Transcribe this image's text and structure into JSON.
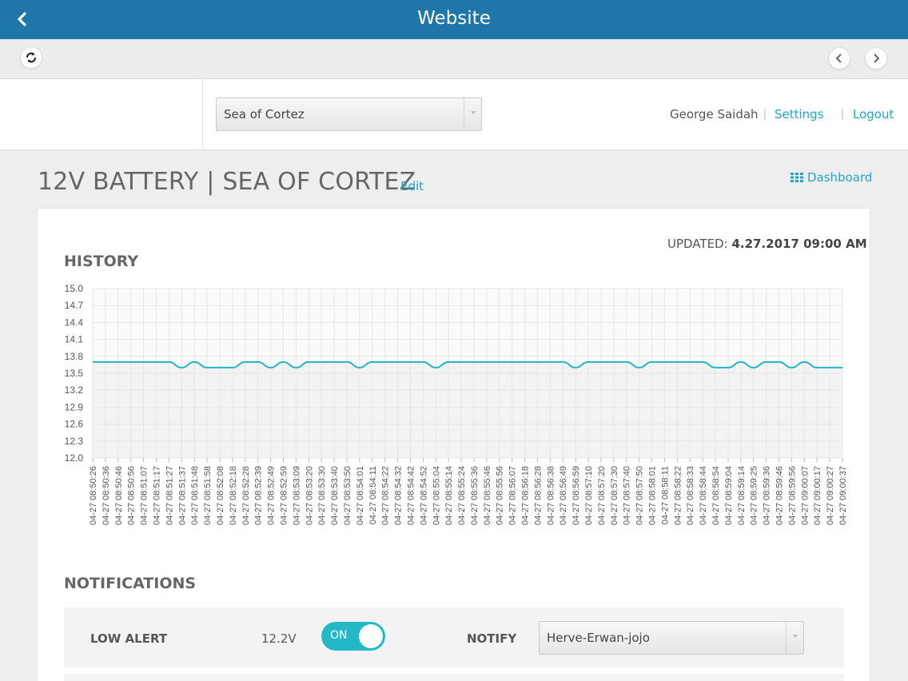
{
  "window": {
    "title": "Website"
  },
  "header": {
    "vessel_select": "Sea of Cortez",
    "user_name": "George Saidah",
    "settings_label": "Settings",
    "logout_label": "Logout",
    "separator": "|"
  },
  "page": {
    "title": "12V BATTERY | SEA OF CORTEZ",
    "edit_label": "Edit",
    "dashboard_label": "Dashboard",
    "updated_label": "UPDATED:",
    "updated_value": "4.27.2017 09:00 AM",
    "history_title": "HISTORY",
    "notifications_title": "NOTIFICATIONS"
  },
  "notification": {
    "low_alert_label": "LOW ALERT",
    "low_alert_value": "12.2V",
    "toggle_label": "ON",
    "toggle_state": "on",
    "notify_label": "NOTIFY",
    "notify_value": "Herve-Erwan-jojo"
  },
  "colors": {
    "accent": "#22a4c9",
    "titlebar": "#1e77a8",
    "line": "#25b3c9",
    "toggle": "#22b8c8"
  },
  "chart_data": {
    "type": "line",
    "title": "",
    "xlabel": "",
    "ylabel": "",
    "ylim": [
      12.0,
      15.0
    ],
    "yticks": [
      "12.0",
      "12.3",
      "12.6",
      "12.9",
      "13.2",
      "13.5",
      "13.8",
      "14.1",
      "14.4",
      "14.7",
      "15.0"
    ],
    "grid": true,
    "x": [
      "04-27 08:50:26",
      "04-27 08:50:36",
      "04-27 08:50:46",
      "04-27 08:50:56",
      "04-27 08:51:07",
      "04-27 08:51:17",
      "04-27 08:51:27",
      "04-27 08:51:37",
      "04-27 08:51:48",
      "04-27 08:51:58",
      "04-27 08:52:08",
      "04-27 08:52:18",
      "04-27 08:52:28",
      "04-27 08:52:39",
      "04-27 08:52:49",
      "04-27 08:52:59",
      "04-27 08:53:09",
      "04-27 08:53:20",
      "04-27 08:53:30",
      "04-27 08:53:40",
      "04-27 08:53:50",
      "04-27 08:54:01",
      "04-27 08:54:11",
      "04-27 08:54:22",
      "04-27 08:54:32",
      "04-27 08:54:42",
      "04-27 08:54:52",
      "04-27 08:55:04",
      "04-27 08:55:14",
      "04-27 08:55:24",
      "04-27 08:55:36",
      "04-27 08:55:46",
      "04-27 08:55:56",
      "04-27 08:56:07",
      "04-27 08:56:18",
      "04-27 08:56:28",
      "04-27 08:56:38",
      "04-27 08:56:49",
      "04-27 08:56:59",
      "04-27 08:57:10",
      "04-27 08:57:20",
      "04-27 08:57:30",
      "04-27 08:57:40",
      "04-27 08:57:50",
      "04-27 08:58:01",
      "04-27 08:58:11",
      "04-27 08:58:22",
      "04-27 08:58:33",
      "04-27 08:58:44",
      "04-27 08:58:54",
      "04-27 08:59:04",
      "04-27 08:59:14",
      "04-27 08:59:25",
      "04-27 08:59:36",
      "04-27 08:59:46",
      "04-27 08:59:56",
      "04-27 09:00:07",
      "04-27 09:00:17",
      "04-27 09:00:27",
      "04-27 09:00:37"
    ],
    "series": [
      {
        "values": [
          13.7,
          13.7,
          13.7,
          13.7,
          13.7,
          13.7,
          13.7,
          13.6,
          13.7,
          13.6,
          13.6,
          13.6,
          13.7,
          13.7,
          13.6,
          13.7,
          13.6,
          13.7,
          13.7,
          13.7,
          13.7,
          13.6,
          13.7,
          13.7,
          13.7,
          13.7,
          13.7,
          13.6,
          13.7,
          13.7,
          13.7,
          13.7,
          13.7,
          13.7,
          13.7,
          13.7,
          13.7,
          13.7,
          13.6,
          13.7,
          13.7,
          13.7,
          13.7,
          13.6,
          13.7,
          13.7,
          13.7,
          13.7,
          13.7,
          13.6,
          13.6,
          13.7,
          13.6,
          13.7,
          13.7,
          13.6,
          13.7,
          13.6,
          13.6,
          13.6
        ]
      }
    ]
  }
}
